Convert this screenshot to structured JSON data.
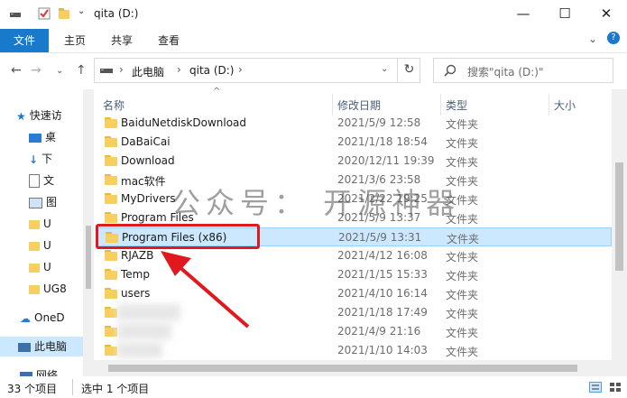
{
  "window": {
    "title": "qita (D:)",
    "minimize_glyph": "—",
    "maximize_glyph": "☐",
    "close_glyph": "✕"
  },
  "ribbon": {
    "tabs": [
      "文件",
      "主页",
      "共享",
      "查看"
    ],
    "help_glyph": "?",
    "expand_glyph": "⌄"
  },
  "address": {
    "back_glyph": "←",
    "forward_glyph": "→",
    "recent_glyph": "⌄",
    "up_glyph": "↑",
    "crumbs": [
      "此电脑",
      "qita (D:)"
    ],
    "separator": "›",
    "dropdown_glyph": "⌄",
    "refresh_glyph": "↻",
    "search_placeholder": "搜索\"qita (D:)\""
  },
  "nav": {
    "items": [
      {
        "label": "快速访",
        "icon": "star-icon"
      },
      {
        "label": "桌",
        "icon": "desktop-icon"
      },
      {
        "label": "下",
        "icon": "download-icon"
      },
      {
        "label": "文",
        "icon": "document-icon"
      },
      {
        "label": "图",
        "icon": "picture-icon"
      },
      {
        "label": "U",
        "icon": "folder-icon"
      },
      {
        "label": "U",
        "icon": "folder-icon"
      },
      {
        "label": "U",
        "icon": "folder-icon"
      },
      {
        "label": "UG8",
        "icon": "folder-icon"
      },
      {
        "label": "OneD",
        "icon": "cloud-icon"
      },
      {
        "label": "此电脑",
        "icon": "computer-icon"
      },
      {
        "label": "网络",
        "icon": "network-icon"
      }
    ]
  },
  "columns": {
    "name": "名称",
    "date": "修改日期",
    "type": "类型",
    "size": "大小",
    "sort_glyph": "^"
  },
  "files": [
    {
      "name": "BaiduNetdiskDownload",
      "date": "2021/5/9 12:58",
      "type": "文件夹"
    },
    {
      "name": "DaBaiCai",
      "date": "2021/1/18 18:54",
      "type": "文件夹"
    },
    {
      "name": "Download",
      "date": "2020/12/11 19:39",
      "type": "文件夹"
    },
    {
      "name": "mac软件",
      "date": "2021/3/6 23:58",
      "type": "文件夹"
    },
    {
      "name": "MyDrivers",
      "date": "2021/2/22 19:25",
      "type": "文件夹"
    },
    {
      "name": "Program Files",
      "date": "2021/5/9 13:37",
      "type": "文件夹"
    },
    {
      "name": "Program Files (x86)",
      "date": "2021/5/9 13:31",
      "type": "文件夹",
      "selected": true
    },
    {
      "name": "RJAZB",
      "date": "2021/4/12 16:08",
      "type": "文件夹"
    },
    {
      "name": "Temp",
      "date": "2021/1/15 15:33",
      "type": "文件夹"
    },
    {
      "name": "users",
      "date": "2021/4/10 16:14",
      "type": "文件夹"
    },
    {
      "name": "",
      "date": "2021/1/18 17:49",
      "type": "文件夹"
    },
    {
      "name": "",
      "date": "2021/4/9 21:16",
      "type": "文件夹"
    },
    {
      "name": "",
      "date": "2021/1/10 14:03",
      "type": "文件夹"
    }
  ],
  "status": {
    "count": "33 个项目",
    "selection": "选中 1 个项目"
  },
  "watermark": "公众号： 开源神器",
  "colors": {
    "accent": "#1979ca",
    "selection": "#cce8ff",
    "highlight": "#e0191f",
    "folder": "#f7cf5e"
  }
}
